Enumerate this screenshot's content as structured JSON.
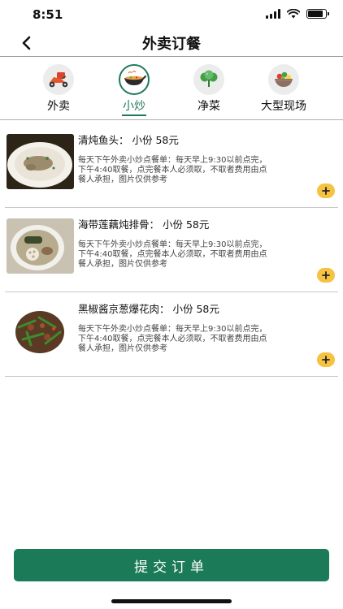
{
  "status_bar": {
    "time": "8:51"
  },
  "nav": {
    "title": "外卖订餐"
  },
  "tabs": [
    {
      "label": "外卖",
      "icon": "scooter-icon",
      "active": false
    },
    {
      "label": "小炒",
      "icon": "wok-icon",
      "active": true
    },
    {
      "label": "净菜",
      "icon": "vegetable-icon",
      "active": false
    },
    {
      "label": "大型现场",
      "icon": "salad-bowl-icon",
      "active": false
    }
  ],
  "items": [
    {
      "name": "清炖鱼头：  小份 58元",
      "desc": "每天下午外卖小炒点餐单：每天早上9:30以前点完，下午4:40取餐，点完餐本人必须取，不取者费用由点餐人承担，图片仅供参考"
    },
    {
      "name": "海带莲藕炖排骨：  小份 58元",
      "desc": "每天下午外卖小炒点餐单：每天早上9:30以前点完，下午4:40取餐，点完餐本人必须取，不取者费用由点餐人承担，图片仅供参考"
    },
    {
      "name": "黑椒酱京葱爆花肉：  小份 58元",
      "desc": "每天下午外卖小炒点餐单：每天早上9:30以前点完，下午4:40取餐，点完餐本人必须取，不取者费用由点餐人承担，图片仅供参考"
    }
  ],
  "footer": {
    "submit_label": "提交订单"
  },
  "colors": {
    "accent": "#1b7a58",
    "add_button": "#f5c242"
  }
}
